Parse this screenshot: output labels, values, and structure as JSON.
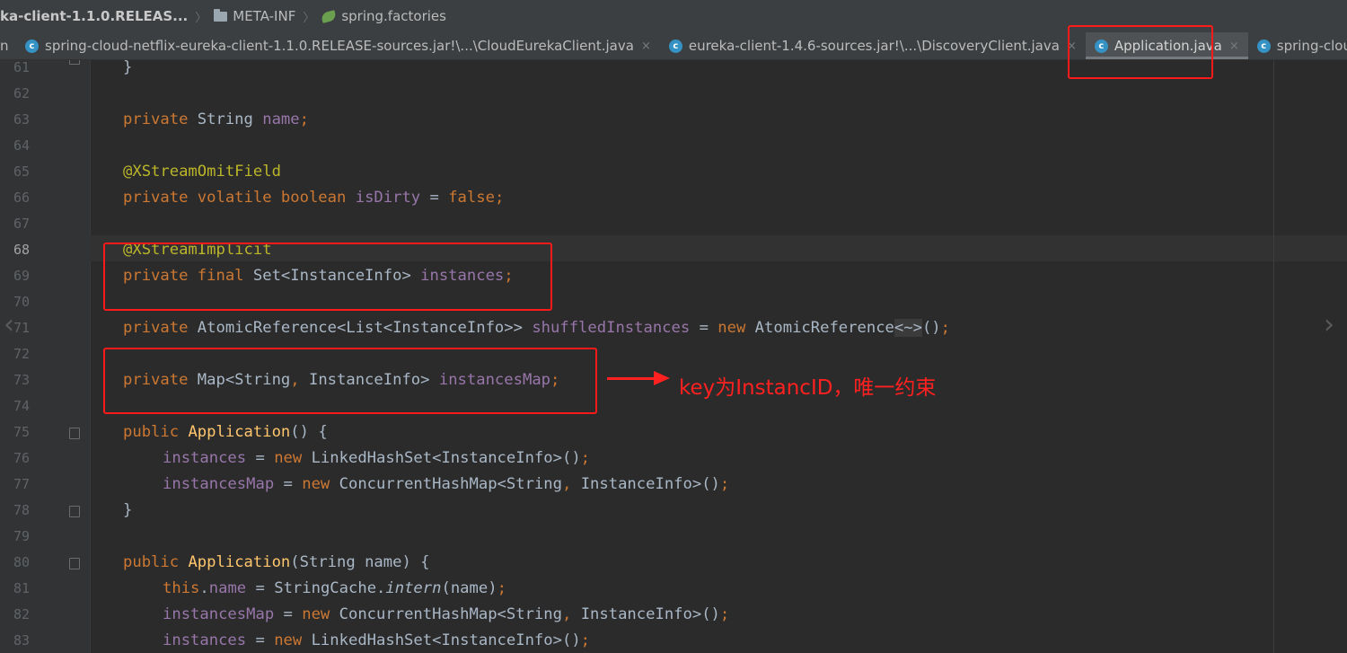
{
  "breadcrumb": {
    "items": [
      "ka-client-1.1.0.RELEAS...",
      "META-INF",
      "spring.factories"
    ]
  },
  "tabs": [
    {
      "label": "spring-cloud-netflix-eureka-client-1.1.0.RELEASE-sources.jar!\\...\\CloudEurekaClient.java",
      "icon": "c",
      "close": "×"
    },
    {
      "label": "eureka-client-1.4.6-sources.jar!\\...\\DiscoveryClient.java",
      "icon": "c",
      "close": "×"
    },
    {
      "label": "Application.java",
      "icon": "c",
      "close": "×",
      "active": true
    },
    {
      "label": "spring-cloud-n",
      "icon": "c"
    }
  ],
  "editor": {
    "current_line": 68,
    "line_numbers": [
      "61",
      "62",
      "63",
      "64",
      "65",
      "66",
      "67",
      "68",
      "69",
      "70",
      "71",
      "72",
      "73",
      "74",
      "75",
      "76",
      "77",
      "78",
      "79",
      "80",
      "81",
      "82",
      "83"
    ]
  },
  "annotation": {
    "note": "key为InstancID，唯一约束",
    "color": "#ff2020"
  },
  "colors": {
    "background": "#2b2b2b",
    "keyword": "#cc7832",
    "annotation": "#bbb529",
    "field": "#9876aa",
    "method": "#ffc66d",
    "text": "#a9b7c6"
  }
}
